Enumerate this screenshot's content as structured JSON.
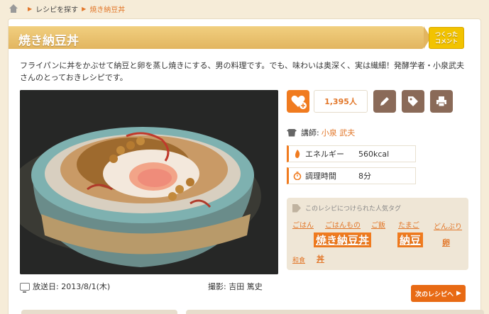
{
  "breadcrumb": {
    "search": "レシピを探す",
    "current": "焼き納豆丼"
  },
  "recipe": {
    "title": "焼き納豆丼",
    "tsukutta_line1": "つくった",
    "tsukutta_line2": "コメント",
    "description": "フライパンに丼をかぶせて納豆と卵を蒸し焼きにする、男の料理です。でも、味わいは奥深く、実は繊細！発酵学者・小泉武夫さんのとっておきレシピです。",
    "favorite_count": "1,395人",
    "instructor_label": "講師:",
    "instructor": "小泉 武夫",
    "energy_label": "エネルギー",
    "energy": "560kcal",
    "time_label": "調理時間",
    "time": "8分",
    "air_date": "放送日: 2013/8/1(木)",
    "photographer": "撮影: 吉田 篤史",
    "next_label": "次のレシピへ"
  },
  "tags": {
    "heading": "このレシピにつけられた人気タグ",
    "items": [
      "ごはん",
      "ごはんもの",
      "ご飯",
      "たまご",
      "どんぶり",
      "焼き納豆丼",
      "納豆",
      "卵",
      "和食",
      "丼"
    ]
  },
  "colors": {
    "accent": "#f07b1f",
    "title_bar": "#e2b560",
    "background": "#f6ecd8"
  }
}
